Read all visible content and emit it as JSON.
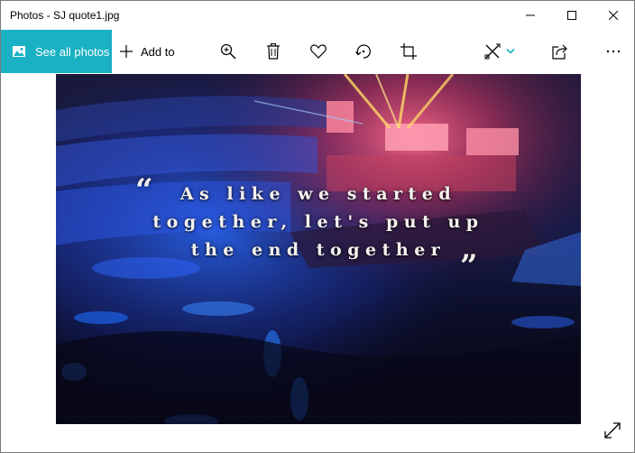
{
  "window": {
    "title": "Photos - SJ quote1.jpg",
    "controls": [
      "minimize",
      "maximize",
      "close"
    ]
  },
  "toolbar": {
    "see_all_label": "See all photos",
    "add_to_label": "Add to",
    "accent_color": "#1ab1c4",
    "icons": [
      "zoom-in-icon",
      "delete-icon",
      "favorite-heart-icon",
      "rotate-icon",
      "crop-icon",
      "edit-create-icon",
      "share-icon",
      "more-icon"
    ]
  },
  "photo": {
    "quote_lines": [
      "As like we started",
      "together, let's put up",
      "the end together"
    ],
    "open_quote": "“",
    "close_quote": "”"
  }
}
